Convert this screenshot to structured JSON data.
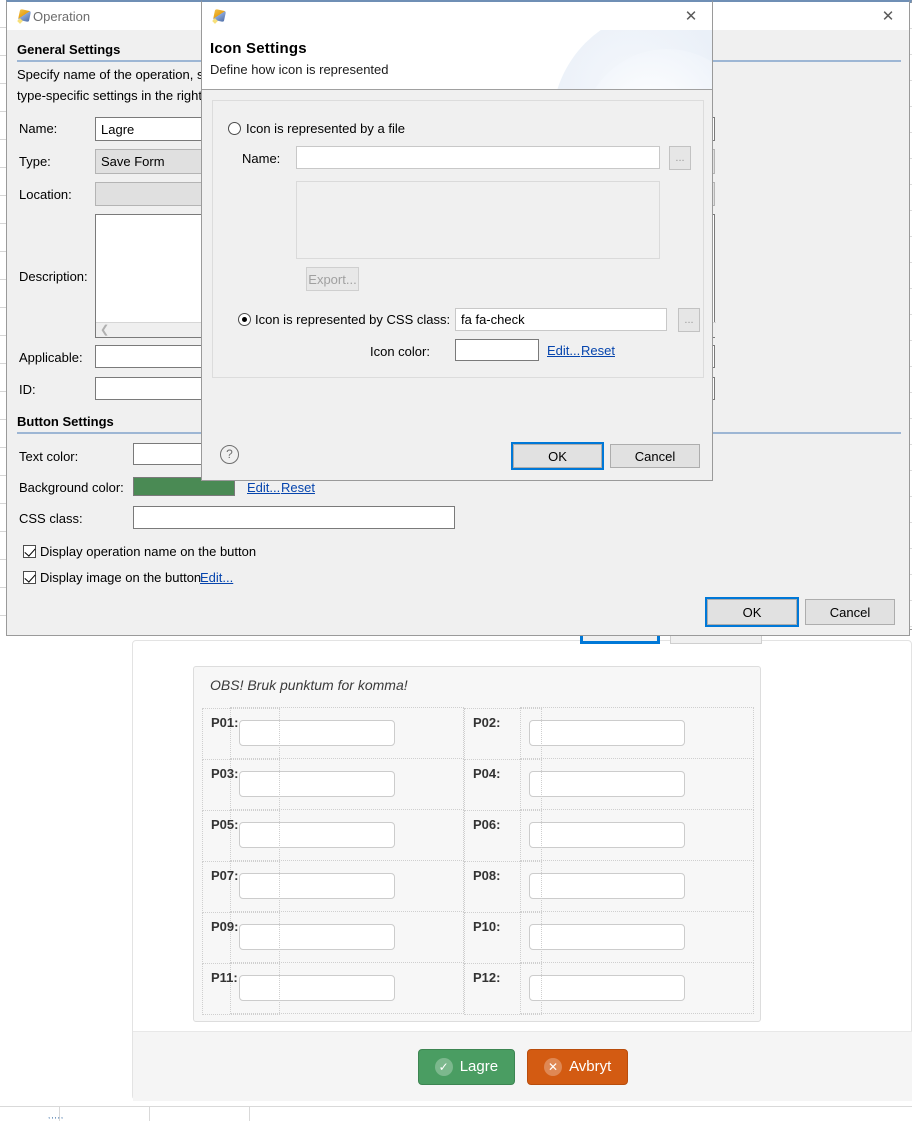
{
  "background_page": {
    "note": "OBS! Bruk punktum for komma!",
    "param_rows": [
      {
        "left_label": "P01:",
        "left_value": "",
        "right_label": "P02:",
        "right_value": ""
      },
      {
        "left_label": "P03:",
        "left_value": "",
        "right_label": "P04:",
        "right_value": ""
      },
      {
        "left_label": "P05:",
        "left_value": "",
        "right_label": "P06:",
        "right_value": ""
      },
      {
        "left_label": "P07:",
        "left_value": "",
        "right_label": "P08:",
        "right_value": ""
      },
      {
        "left_label": "P09:",
        "left_value": "",
        "right_label": "P10:",
        "right_value": ""
      },
      {
        "left_label": "P11:",
        "left_value": "",
        "right_label": "P12:",
        "right_value": ""
      }
    ],
    "actions": {
      "save_label": "Lagre",
      "save_icon": "check-circle-icon",
      "save_color": "#4a9d62",
      "cancel_label": "Avbryt",
      "cancel_icon": "times-circle-icon",
      "cancel_color": "#d35b12"
    }
  },
  "operation_dialog": {
    "window_title": "Operation",
    "window_icon": "application-icon",
    "close_icon": "close-icon",
    "general_section": {
      "title": "General Settings",
      "description_line1": "Specify name of the operation, sele",
      "description_line2": "type-specific settings in the right pa",
      "fields": {
        "name_label": "Name:",
        "name_value": "Lagre",
        "type_label": "Type:",
        "type_value": "Save Form",
        "location_label": "Location:",
        "location_value": "",
        "description_label": "Description:",
        "description_value": "",
        "applicable_label": "Applicable:",
        "applicable_value": "",
        "id_label": "ID:",
        "id_value": ""
      }
    },
    "button_section": {
      "title": "Button Settings",
      "text_color_label": "Text color:",
      "text_color_value": "",
      "background_color_label": "Background color:",
      "background_color_value": "#4a8a54",
      "background_edit_label": "Edit...",
      "background_reset_label": "Reset",
      "css_class_label": "CSS class:",
      "css_class_value": "",
      "display_name_checkbox": "Display operation name on the button",
      "display_name_checked": true,
      "display_image_checkbox": "Display image on the button",
      "display_image_checked": true,
      "display_image_edit_label": "Edit..."
    },
    "footer": {
      "ok_label": "OK",
      "cancel_label": "Cancel"
    }
  },
  "icon_settings_dialog": {
    "window_icon": "application-icon",
    "close_icon": "close-icon",
    "header_title": "Icon Settings",
    "header_subtitle": "Define how icon is represented",
    "file_option": {
      "radio_label": "Icon is represented by a file",
      "selected": false,
      "name_label": "Name:",
      "name_value": "",
      "browse_label": "...",
      "preview_value": "",
      "export_label": "Export...",
      "export_enabled": false
    },
    "css_option": {
      "radio_label": "Icon is represented by CSS class:",
      "selected": true,
      "css_class_value": "fa fa-check",
      "browse_label": "...",
      "icon_color_label": "Icon color:",
      "icon_color_value": "",
      "edit_label": "Edit...",
      "reset_label": "Reset"
    },
    "footer": {
      "help_icon": "help-icon",
      "ok_label": "OK",
      "cancel_label": "Cancel"
    }
  }
}
